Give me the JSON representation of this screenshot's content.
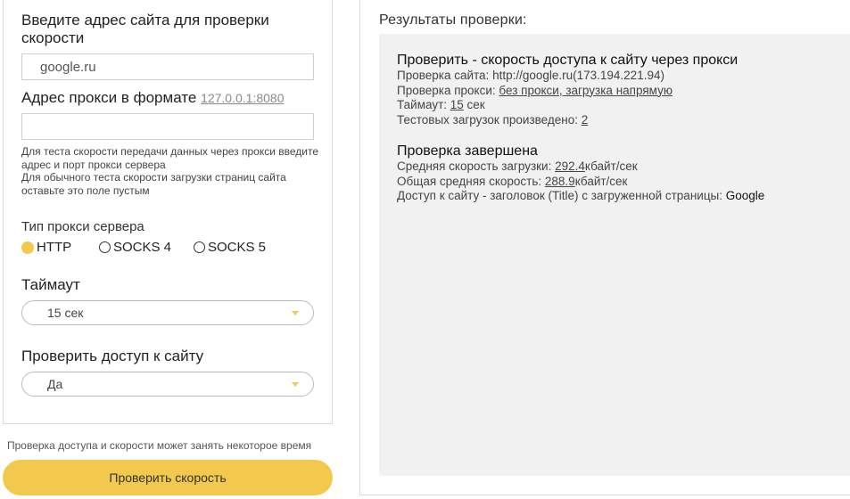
{
  "form": {
    "url_label": "Введите адрес сайта для проверки скорости",
    "url_value": "google.ru",
    "proxy_label": "Адрес прокси в формате",
    "proxy_example": "127.0.0.1:8080",
    "proxy_value": "",
    "hint_line1": "Для теста скорости передачи данных через прокси введите адрес и порт прокси сервера",
    "hint_line2": "Для обычного теста скорости загрузки страниц сайта оставьте это поле пустым",
    "proxy_type_label": "Тип прокси сервера",
    "proxy_types": [
      "HTTP",
      "SOCKS 4",
      "SOCKS 5"
    ],
    "proxy_type_selected": "HTTP",
    "timeout_label": "Таймаут",
    "timeout_value": "15 сек",
    "access_label": "Проверить доступ к сайту",
    "access_value": "Да",
    "note": "Проверка доступа и скорости может занять некоторое время",
    "submit_label": "Проверить скорость"
  },
  "results": {
    "title": "Результаты проверки:",
    "block1": {
      "heading": "Проверить - скорость доступа к сайту через прокси",
      "site_prefix": "Проверка сайта: ",
      "site_value": "http://google.ru(173.194.221.94)",
      "proxy_prefix": "Проверка прокси: ",
      "proxy_value": "без прокси, загрузка напрямую",
      "timeout_prefix": "Таймаут: ",
      "timeout_value": "15",
      "timeout_suffix": " сек",
      "tests_prefix": "Тестовых загрузок произведено: ",
      "tests_value": "2"
    },
    "block2": {
      "heading": "Проверка завершена",
      "avg_prefix": "Средняя скорость загрузки: ",
      "avg_value": "292.4",
      "avg_suffix": "кбайт/сек",
      "total_prefix": "Общая средняя скорость: ",
      "total_value": "288.9",
      "total_suffix": "кбайт/сек",
      "title_prefix": "Доступ к сайту - заголовок (Title) с загруженной страницы: ",
      "title_value": "Google"
    }
  },
  "colors": {
    "accent": "#f2c94c",
    "results_bg": "#f1f1f1"
  }
}
